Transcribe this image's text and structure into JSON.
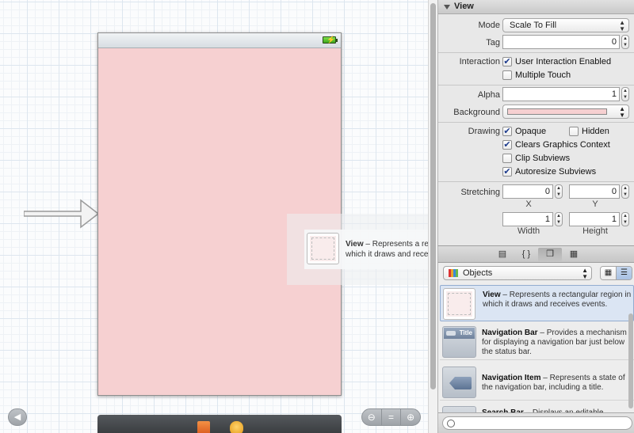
{
  "inspector": {
    "section_title": "View",
    "mode": {
      "label": "Mode",
      "value": "Scale To Fill"
    },
    "tag": {
      "label": "Tag",
      "value": "0"
    },
    "interaction": {
      "label": "Interaction",
      "user_interaction_enabled": {
        "label": "User Interaction Enabled",
        "checked": true
      },
      "multiple_touch": {
        "label": "Multiple Touch",
        "checked": false
      }
    },
    "alpha": {
      "label": "Alpha",
      "value": "1"
    },
    "background": {
      "label": "Background",
      "color": "#f6d0d1"
    },
    "drawing": {
      "label": "Drawing",
      "opaque": {
        "label": "Opaque",
        "checked": true
      },
      "hidden": {
        "label": "Hidden",
        "checked": false
      },
      "clears_graphics_context": {
        "label": "Clears Graphics Context",
        "checked": true
      },
      "clip_subviews": {
        "label": "Clip Subviews",
        "checked": false
      },
      "autoresize_subviews": {
        "label": "Autoresize Subviews",
        "checked": true
      }
    },
    "stretching": {
      "label": "Stretching",
      "x": {
        "caption": "X",
        "value": "0"
      },
      "y": {
        "caption": "Y",
        "value": "0"
      },
      "width": {
        "caption": "Width",
        "value": "1"
      },
      "height": {
        "caption": "Height",
        "value": "1"
      }
    }
  },
  "library": {
    "tabs": [
      "file-template-icon",
      "code-snippet-icon",
      "object-cube-icon",
      "media-icon"
    ],
    "active_tab": 2,
    "selector": "Objects",
    "items": [
      {
        "title": "View",
        "description": " – Represents a rectangular region in which it draws and receives events."
      },
      {
        "title": "Navigation Bar",
        "description": " – Provides a mechanism for displaying a navigation bar just below the status bar.",
        "badge": "Title"
      },
      {
        "title": "Navigation Item",
        "description": " – Represents a state of the navigation bar, including a title."
      },
      {
        "title": "Search Bar",
        "description": " – Displays an editable"
      }
    ]
  },
  "drag_tooltip": {
    "title": "View",
    "description": " – Represents a rectangular region in which it draws and receives events."
  },
  "canvas": {
    "view_background": "#f6d0d1",
    "status_bar_icon": "battery-charging-icon"
  },
  "colors": {
    "accent": "#3b6fd6",
    "check": "#1d3b8c"
  }
}
